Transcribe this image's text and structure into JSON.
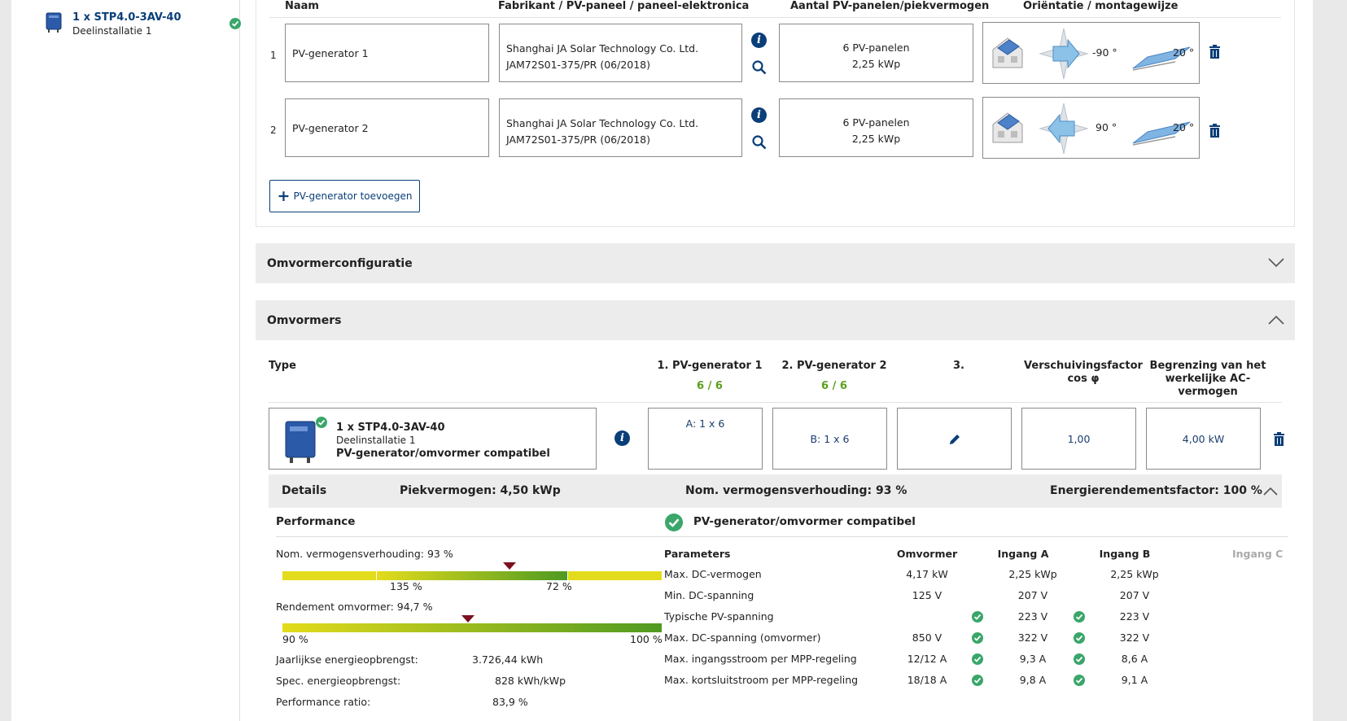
{
  "sidebar": {
    "item_title": "1 x STP4.0-3AV-40",
    "item_subtitle": "Deelinstallatie 1"
  },
  "pv_table": {
    "headers": [
      "Naam",
      "Fabrikant / PV-paneel / paneel-elektronica",
      "Aantal PV-panelen/piekvermogen",
      "Oriëntatie / montagewijze"
    ],
    "rows": [
      {
        "num": "1",
        "name": "PV-generator 1",
        "manufacturer": "Shanghai JA Solar Technology Co. Ltd.",
        "module": "JAM72S01-375/PR (06/2018)",
        "count": "6 PV-panelen",
        "power": "2,25 kWp",
        "azimuth": "-90 °",
        "tilt": "20 °"
      },
      {
        "num": "2",
        "name": "PV-generator 2",
        "manufacturer": "Shanghai JA Solar Technology Co. Ltd.",
        "module": "JAM72S01-375/PR (06/2018)",
        "count": "6 PV-panelen",
        "power": "2,25 kWp",
        "azimuth": "90 °",
        "tilt": "20 °"
      }
    ],
    "add_button": "PV-generator toevoegen"
  },
  "sections": {
    "config": "Omvormerconfiguratie",
    "inverters": "Omvormers"
  },
  "inverters": {
    "headers": {
      "type": "Type",
      "gen1": "1. PV-generator 1",
      "gen1_count": "6 / 6",
      "gen2": "2. PV-generator 2",
      "gen2_count": "6 / 6",
      "gen3": "3.",
      "cos_line1": "Verschuivingsfactor",
      "cos_line2": "cos φ",
      "lim_line1": "Begrenzing van het",
      "lim_line2": "werkelijke AC-",
      "lim_line3": "vermogen"
    },
    "row": {
      "title": "1 x STP4.0-3AV-40",
      "subtitle": "Deelinstallatie 1",
      "status": "PV-generator/omvormer compatibel",
      "input_a": "A: 1 x 6",
      "input_b": "B: 1 x 6",
      "cos_phi": "1,00",
      "ac_limit": "4,00 kW"
    }
  },
  "details": {
    "label": "Details",
    "peak": "Piekvermogen: 4,50 kWp",
    "ratio": "Nom. vermogensverhouding: 93 %",
    "energy_factor": "Energierendementsfactor: 100 %"
  },
  "performance": {
    "title": "Performance",
    "ratio_label": "Nom. vermogensverhouding: 93 %",
    "ratio_value": 93,
    "ratio_tick_left": "135 %",
    "ratio_tick_right": "72 %",
    "efficiency_label": "Rendement omvormer: 94,7 %",
    "efficiency_value": 94.7,
    "eff_tick_left": "90 %",
    "eff_tick_right": "100 %",
    "annual_label": "Jaarlijkse energieopbrengst:",
    "annual_value": "3.726,44 kWh",
    "spec_label": "Spec. energieopbrengst:",
    "spec_value": "828 kWh/kWp",
    "pr_label": "Performance ratio:",
    "pr_value": "83,9 %"
  },
  "compat": {
    "title": "PV-generator/omvormer compatibel",
    "headers": [
      "Parameters",
      "Omvormer",
      "Ingang A",
      "Ingang B",
      "Ingang C"
    ],
    "rows": [
      {
        "param": "Max. DC-vermogen",
        "inv": "4,17 kW",
        "a": "2,25 kWp",
        "b": "2,25 kWp",
        "ok": false
      },
      {
        "param": "Min. DC-spanning",
        "inv": "125 V",
        "a": "207 V",
        "b": "207 V",
        "ok": false
      },
      {
        "param": "Typische PV-spanning",
        "inv": "",
        "a": "223 V",
        "b": "223 V",
        "ok": true
      },
      {
        "param": "Max. DC-spanning (omvormer)",
        "inv": "850 V",
        "a": "322 V",
        "b": "322 V",
        "ok": true
      },
      {
        "param": "Max. ingangsstroom per MPP-regeling",
        "inv": "12/12 A",
        "a": "9,3 A",
        "b": "8,6 A",
        "ok": true
      },
      {
        "param": "Max. kortsluitstroom per MPP-regeling",
        "inv": "18/18 A",
        "a": "9,8 A",
        "b": "9,1 A",
        "ok": true
      }
    ]
  },
  "colors": {
    "brand_blue": "#0a3e78",
    "ok_green": "#3aa66a",
    "marker": "#7a1020",
    "bar_yellow": "#e3dc1c",
    "bar_green": "#4f9a22"
  }
}
